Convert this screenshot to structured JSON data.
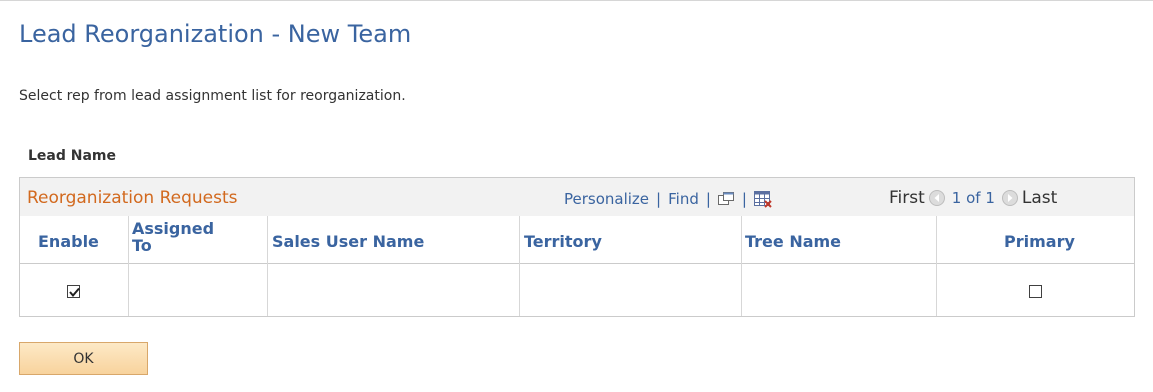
{
  "page": {
    "title": "Lead Reorganization - New Team",
    "instruction": "Select rep from lead assignment list for reorganization.",
    "section_label": "Lead Name"
  },
  "grid": {
    "title": "Reorganization Requests",
    "tools": {
      "personalize": "Personalize",
      "find": "Find",
      "separator": "|",
      "view_icon": "zoom-window-icon",
      "download_icon": "download-excel-icon"
    },
    "nav": {
      "first": "First",
      "count": "1 of 1",
      "last": "Last"
    },
    "columns": {
      "enable": "Enable",
      "assigned_to_line1": "Assigned",
      "assigned_to_line2": "To",
      "sales_user_name": "Sales User Name",
      "territory": "Territory",
      "tree_name": "Tree Name",
      "primary": "Primary"
    },
    "rows": [
      {
        "enable": true,
        "assigned_to": "",
        "sales_user_name": "",
        "territory": "",
        "tree_name": "",
        "primary": false
      }
    ]
  },
  "buttons": {
    "ok": "OK"
  },
  "colors": {
    "title_blue": "#3a64a0",
    "grid_title_orange": "#d2691e",
    "button_fill": "#f8d39d"
  }
}
